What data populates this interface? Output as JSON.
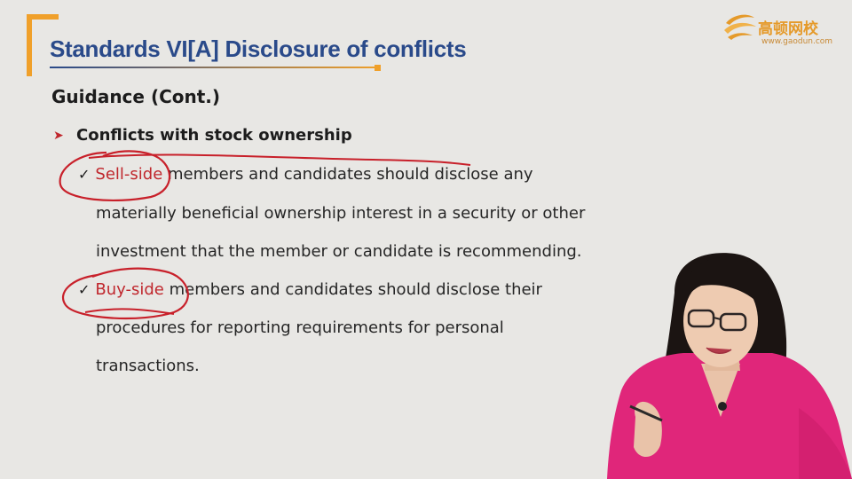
{
  "slide": {
    "title": "Standards VI[A] Disclosure of conflicts",
    "subheading": "Guidance (Cont.)",
    "bullet": "Conflicts with stock ownership",
    "item1": {
      "check": "✓",
      "highlight": "Sell-side",
      "line1_rest": " members and candidates should disclose any",
      "line2": "materially beneficial ownership interest in a security or other",
      "line3": "investment that the member or candidate is recommending."
    },
    "item2": {
      "check": "✓",
      "highlight": "Buy-side",
      "line1_rest": " members and candidates should disclose their",
      "line2": "procedures for reporting requirements for personal",
      "line3": "transactions."
    }
  },
  "logo": {
    "name": "高顿网校",
    "url": "www.gaodun.com"
  },
  "colors": {
    "title": "#2a4a8a",
    "accent": "#f0a02a",
    "highlight": "#c0272d",
    "annotation": "#c8202a",
    "presenter_top": "#e0267a"
  }
}
